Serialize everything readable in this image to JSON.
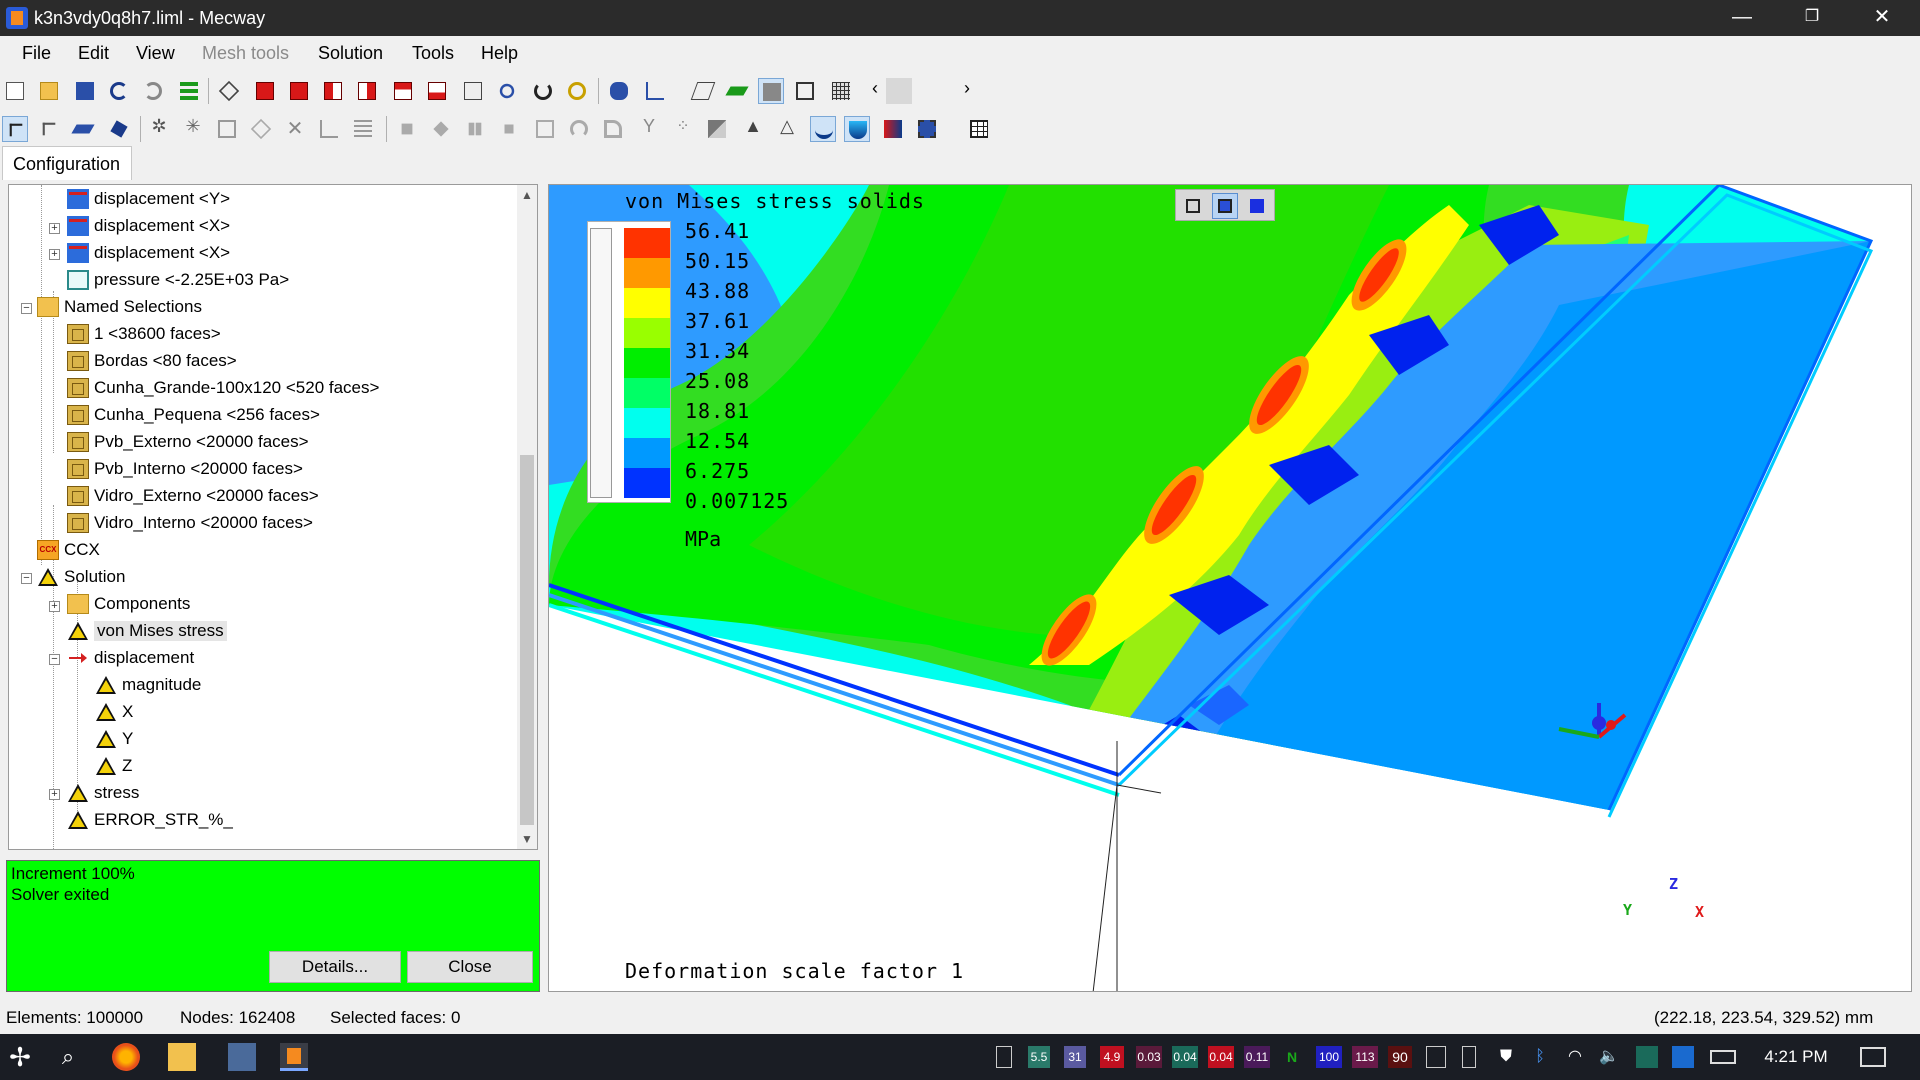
{
  "window": {
    "title": "k3n3vdy0q8h7.liml - Mecway",
    "minimize": "—",
    "restore": "❐",
    "close": "✕"
  },
  "menu": [
    "File",
    "Edit",
    "View",
    "Mesh tools",
    "Solution",
    "Tools",
    "Help"
  ],
  "toolbar1_icons": [
    "new-file-icon",
    "open-folder-icon",
    "save-icon",
    "undo-icon",
    "redo-icon",
    "layers-icon",
    "wireframe-cube-icon",
    "red-cube-front-icon",
    "red-cube-back-icon",
    "red-cube-left-icon",
    "red-cube-right-icon",
    "red-cube-top-icon",
    "red-cube-bottom-icon",
    "zoom-box-icon",
    "zoom-icon",
    "rotate-icon",
    "zoom-fit-icon",
    "render-mode-icon",
    "axes-dropdown-icon",
    "clip-plane-icon",
    "surface-plane-icon",
    "shaded-cube-icon",
    "outline-cube-icon",
    "mesh-cube-icon",
    "scroll-left-icon",
    "blank-icon",
    "scroll-right-icon"
  ],
  "toolbar2_icons": [
    "select-pointer-icon",
    "select-node-icon",
    "select-edge-icon",
    "select-face-icon",
    "node-star-icon",
    "node-star-outline-icon",
    "square-icon",
    "cube-outline-icon",
    "delete-icon",
    "extrude-icon",
    "sweep-icon",
    "move-icon",
    "transform-icon",
    "mirror-icon",
    "scale-icon",
    "box-icon",
    "revolve-icon",
    "bend-icon",
    "split-icon",
    "points-icon",
    "refine-icon",
    "triangle-mesh-icon",
    "triangle-outline-icon",
    "contour-bowl-icon",
    "contour-bowl-fill-icon",
    "animation-icon",
    "movie-icon",
    "table-icon"
  ],
  "tabs": {
    "configuration": "Configuration"
  },
  "tree": [
    {
      "label": "displacement <Y>",
      "icon": "displacement-icon"
    },
    {
      "label": "displacement <X>",
      "icon": "displacement-icon"
    },
    {
      "label": "displacement <X>",
      "icon": "displacement-icon"
    },
    {
      "label": "pressure <-2.25E+03 Pa>",
      "icon": "pressure-icon"
    },
    {
      "label": "Named Selections",
      "icon": "folder-icon"
    },
    {
      "label": "1 <38600 faces>",
      "icon": "selection-icon"
    },
    {
      "label": "Bordas <80 faces>",
      "icon": "selection-icon"
    },
    {
      "label": "Cunha_Grande-100x120 <520 faces>",
      "icon": "selection-icon"
    },
    {
      "label": "Cunha_Pequena <256 faces>",
      "icon": "selection-icon"
    },
    {
      "label": "Pvb_Externo <20000 faces>",
      "icon": "selection-icon"
    },
    {
      "label": "Pvb_Interno <20000 faces>",
      "icon": "selection-icon"
    },
    {
      "label": "Vidro_Externo <20000 faces>",
      "icon": "selection-icon"
    },
    {
      "label": "Vidro_Interno <20000 faces>",
      "icon": "selection-icon"
    },
    {
      "label": "CCX",
      "icon": "ccx-icon"
    },
    {
      "label": "Solution",
      "icon": "solution-icon"
    },
    {
      "label": "Components",
      "icon": "components-icon"
    },
    {
      "label": "von Mises stress",
      "icon": "result-triangle-icon",
      "selected": true
    },
    {
      "label": "displacement",
      "icon": "displacement-arrow-icon"
    },
    {
      "label": "magnitude",
      "icon": "result-triangle-icon"
    },
    {
      "label": "X",
      "icon": "result-triangle-icon"
    },
    {
      "label": "Y",
      "icon": "result-triangle-icon"
    },
    {
      "label": "Z",
      "icon": "result-triangle-icon"
    },
    {
      "label": "stress",
      "icon": "result-triangle-icon"
    },
    {
      "label": "ERROR_STR_%_",
      "icon": "result-triangle-icon"
    }
  ],
  "solver_status": {
    "line1": "Increment 100%",
    "line2": "Solver exited",
    "details_button": "Details...",
    "close_button": "Close",
    "background": "#00ff00"
  },
  "viewport": {
    "legend_title": "von Mises stress solids",
    "legend_values": [
      "56.41",
      "50.15",
      "43.88",
      "37.61",
      "31.34",
      "25.08",
      "18.81",
      "12.54",
      "6.275",
      "0.007125"
    ],
    "legend_colors": [
      "#ff3300",
      "#ff9900",
      "#ffff00",
      "#99ff00",
      "#00ee00",
      "#00ff66",
      "#00ffee",
      "#0099ff",
      "#0033ff"
    ],
    "legend_unit": "MPa",
    "deformation_label": "Deformation scale factor 1",
    "axis_labels": {
      "x": "X",
      "y": "Y",
      "z": "Z"
    }
  },
  "statusbar": {
    "elements": "Elements: 100000",
    "nodes": "Nodes: 162408",
    "selected": "Selected faces: 0",
    "coords": "(222.18, 223.54, 329.52) mm"
  },
  "taskbar": {
    "tray_badges": [
      "5.5",
      "31",
      "4.9",
      "0.03",
      "0.04",
      "0.04",
      "0.11",
      "N",
      "100",
      "113",
      "90"
    ],
    "badge_colors": [
      "#2a7a6a",
      "#5a5aa0",
      "#c01020",
      "#5a1a3a",
      "#1a6a5a",
      "#c01020",
      "#4a1a5a",
      "#1a1d24",
      "#2020c0",
      "#6a1a4a",
      "#5a1010"
    ],
    "time": "4:21 PM"
  }
}
